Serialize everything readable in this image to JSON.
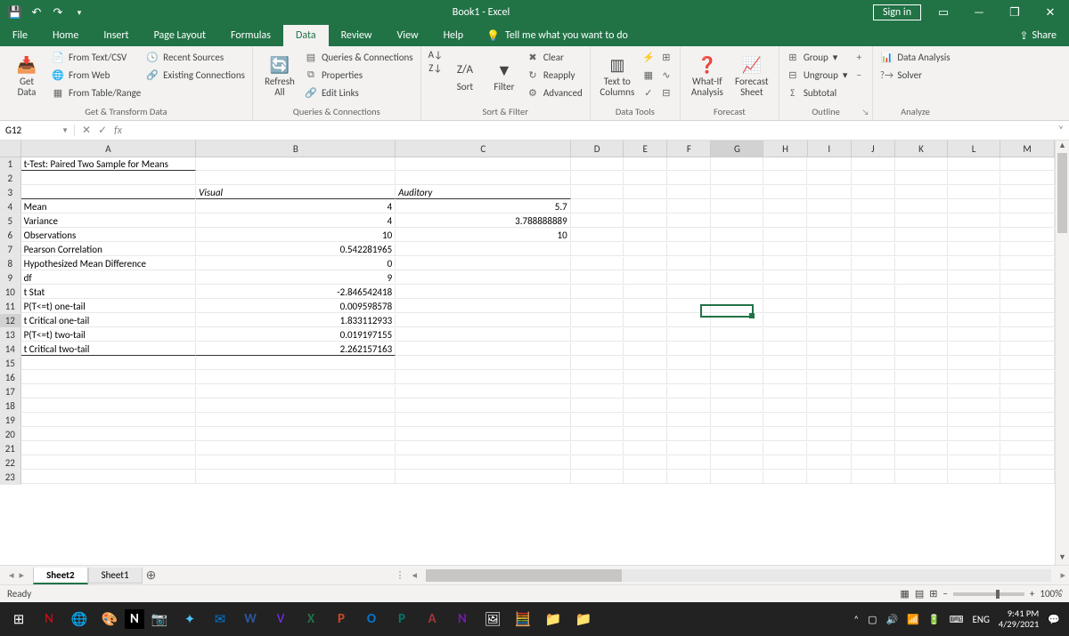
{
  "titlebar": {
    "title": "Book1 - Excel",
    "signin": "Sign in"
  },
  "tabs": [
    "File",
    "Home",
    "Insert",
    "Page Layout",
    "Formulas",
    "Data",
    "Review",
    "View",
    "Help"
  ],
  "active_tab": "Data",
  "tellme": "Tell me what you want to do",
  "share": "Share",
  "ribbon": {
    "get_transform": {
      "label": "Get & Transform Data",
      "big": "Get\nData",
      "items": [
        "From Text/CSV",
        "Recent Sources",
        "From Web",
        "Existing Connections",
        "From Table/Range"
      ]
    },
    "queries": {
      "label": "Queries & Connections",
      "big": "Refresh\nAll",
      "items": [
        "Queries & Connections",
        "Properties",
        "Edit Links"
      ]
    },
    "sort_filter": {
      "label": "Sort & Filter",
      "sort": "Sort",
      "filter": "Filter",
      "items": [
        "Clear",
        "Reapply",
        "Advanced"
      ]
    },
    "data_tools": {
      "label": "Data Tools",
      "big": "Text to\nColumns"
    },
    "forecast": {
      "label": "Forecast",
      "whatif": "What-If\nAnalysis",
      "sheet": "Forecast\nSheet"
    },
    "outline": {
      "label": "Outline",
      "items": [
        "Group",
        "Ungroup",
        "Subtotal"
      ]
    },
    "analyze": {
      "label": "Analyze",
      "items": [
        "Data Analysis",
        "Solver"
      ]
    }
  },
  "namebox": "G12",
  "columns": [
    "A",
    "B",
    "C",
    "D",
    "E",
    "F",
    "G",
    "H",
    "I",
    "J",
    "K",
    "L",
    "M"
  ],
  "rows": 23,
  "cells": {
    "A1": "t-Test: Paired Two Sample for Means",
    "B3": "Visual",
    "C3": "Auditory",
    "A4": "Mean",
    "B4": "4",
    "C4": "5.7",
    "A5": "Variance",
    "B5": "4",
    "C5": "3.788888889",
    "A6": "Observations",
    "B6": "10",
    "C6": "10",
    "A7": "Pearson Correlation",
    "B7": "0.542281965",
    "A8": "Hypothesized Mean Difference",
    "B8": "0",
    "A9": "df",
    "B9": "9",
    "A10": "t Stat",
    "B10": "-2.846542418",
    "A11": "P(T<=t) one-tail",
    "B11": "0.009598578",
    "A12": "t Critical one-tail",
    "B12": "1.833112933",
    "A13": "P(T<=t) two-tail",
    "B13": "0.019197155",
    "A14": "t Critical two-tail",
    "B14": "2.262157163"
  },
  "selected_cell": "G12",
  "sheets": {
    "active": "Sheet2",
    "inactive": "Sheet1"
  },
  "status": {
    "ready": "Ready",
    "zoom": "100%"
  },
  "tray": {
    "lang": "ENG",
    "time": "9:41 PM",
    "date": "4/29/2021"
  }
}
